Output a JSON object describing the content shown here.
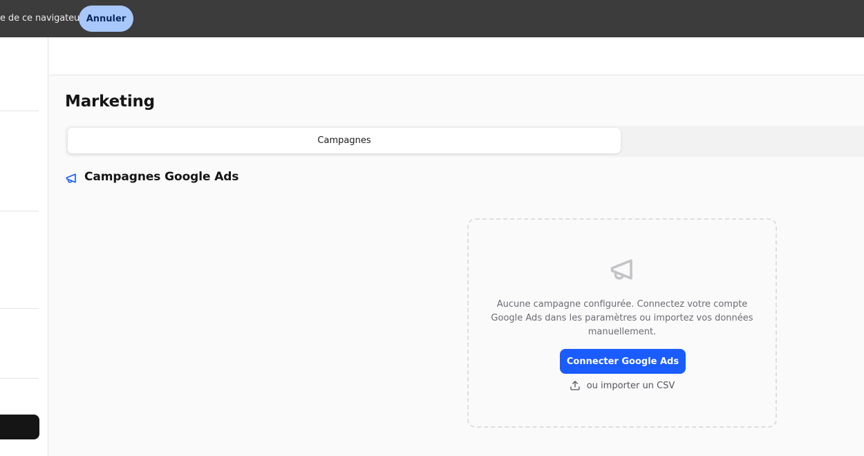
{
  "topbar": {
    "text": "e de ce navigateur",
    "cancel_label": "Annuler"
  },
  "page": {
    "title": "Marketing"
  },
  "tabs": [
    {
      "label": "Campagnes",
      "active": true
    }
  ],
  "section": {
    "title": "Campagnes Google Ads",
    "icon": "megaphone-icon"
  },
  "empty_state": {
    "icon": "megaphone-icon",
    "message": "Aucune campagne configurée. Connectez votre compte Google Ads dans les paramètres ou importez vos données manuellement.",
    "connect_label": "Connecter Google Ads",
    "import_label": "ou importer un CSV",
    "import_icon": "upload-icon"
  },
  "colors": {
    "accent": "#1a5cff",
    "topbar_bg": "#3c3c3c",
    "cancel_bg": "#a8c7fa"
  }
}
